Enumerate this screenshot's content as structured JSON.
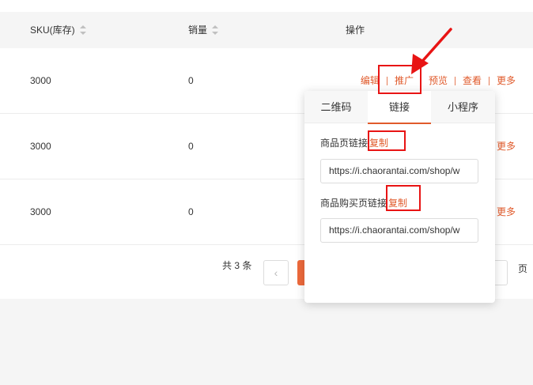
{
  "table": {
    "headers": {
      "sku": "SKU(库存)",
      "sales": "销量",
      "actions": "操作"
    },
    "rows": [
      {
        "sku": "3000",
        "sales": "0"
      },
      {
        "sku": "3000",
        "sales": "0"
      },
      {
        "sku": "3000",
        "sales": "0"
      }
    ],
    "row_actions": {
      "edit": "编辑",
      "promote": "推广",
      "preview": "预览",
      "view": "查看",
      "more": "更多"
    }
  },
  "pagination": {
    "total": "共 3 条",
    "prev": "‹",
    "page_suffix": "页"
  },
  "promote_popover": {
    "tabs": [
      "二维码",
      "链接",
      "小程序"
    ],
    "active_tab": "链接",
    "product_link_label": "商品页链接",
    "buy_link_label": "商品购买页链接",
    "copy_label": "复制",
    "product_link_value": "https://i.chaorantai.com/shop/w",
    "buy_link_value": "https://i.chaorantai.com/shop/w"
  },
  "colors": {
    "accent": "#e05a2b",
    "annotation": "#e81414"
  }
}
